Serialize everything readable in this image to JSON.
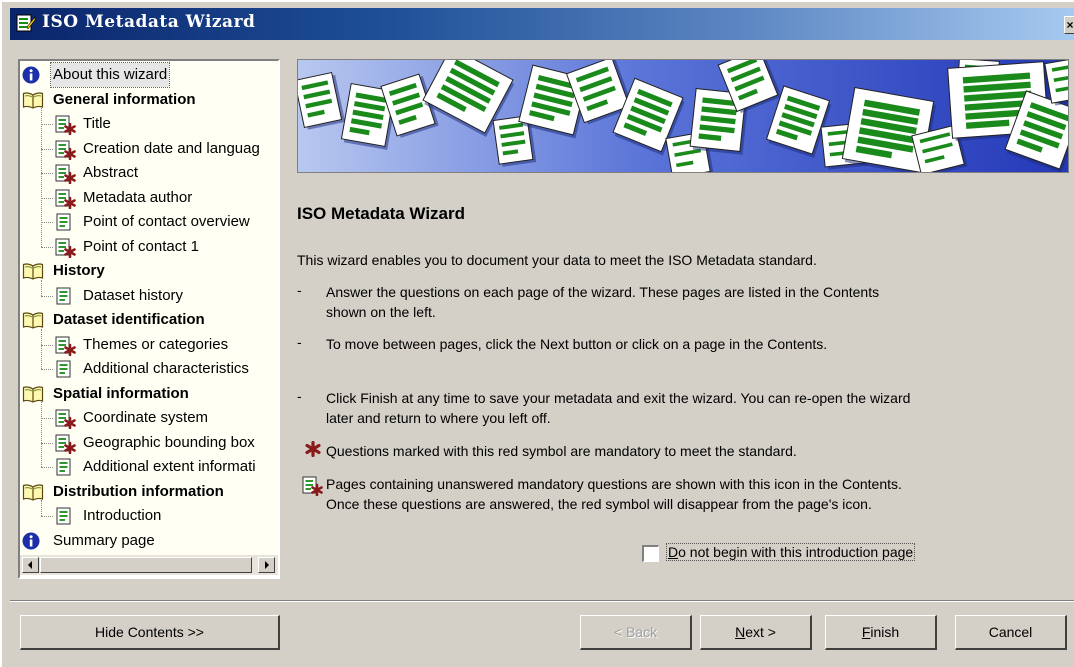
{
  "window": {
    "title": "ISO Metadata Wizard",
    "close_glyph": "×"
  },
  "tree": {
    "items": [
      {
        "label": "About this wizard",
        "level": 0,
        "icon": "info-icon",
        "bold": false,
        "selected": true
      },
      {
        "label": "General information",
        "level": 0,
        "icon": "book-icon",
        "bold": true
      },
      {
        "label": "Title",
        "level": 1,
        "icon": "page-mandatory-icon"
      },
      {
        "label": "Creation date and languag",
        "level": 1,
        "icon": "page-mandatory-icon"
      },
      {
        "label": "Abstract",
        "level": 1,
        "icon": "page-mandatory-icon"
      },
      {
        "label": "Metadata author",
        "level": 1,
        "icon": "page-mandatory-icon"
      },
      {
        "label": "Point of contact overview",
        "level": 1,
        "icon": "page-icon"
      },
      {
        "label": "Point of contact 1",
        "level": 1,
        "icon": "page-mandatory-icon"
      },
      {
        "label": "History",
        "level": 0,
        "icon": "book-icon",
        "bold": true
      },
      {
        "label": "Dataset history",
        "level": 1,
        "icon": "page-icon"
      },
      {
        "label": "Dataset identification",
        "level": 0,
        "icon": "book-icon",
        "bold": true
      },
      {
        "label": "Themes or categories",
        "level": 1,
        "icon": "page-mandatory-icon"
      },
      {
        "label": "Additional characteristics",
        "level": 1,
        "icon": "page-icon"
      },
      {
        "label": "Spatial information",
        "level": 0,
        "icon": "book-icon",
        "bold": true
      },
      {
        "label": "Coordinate system",
        "level": 1,
        "icon": "page-mandatory-icon"
      },
      {
        "label": "Geographic bounding box",
        "level": 1,
        "icon": "page-mandatory-icon"
      },
      {
        "label": "Additional extent informati",
        "level": 1,
        "icon": "page-icon"
      },
      {
        "label": "Distribution information",
        "level": 0,
        "icon": "book-icon",
        "bold": true
      },
      {
        "label": "Introduction",
        "level": 1,
        "icon": "page-icon"
      },
      {
        "label": "Summary page",
        "level": 0,
        "icon": "info-icon",
        "bold": false
      }
    ]
  },
  "content": {
    "heading": "ISO Metadata Wizard",
    "intro": "This wizard enables you to document your data to meet the ISO Metadata standard.",
    "bullet1_line1": "Answer the questions on each page of the wizard.  These pages are listed in the Contents",
    "bullet1_line2": "shown on the left.",
    "bullet2": "To move between pages, click the Next button or click on a page in the Contents.",
    "bullet3_line1": "Click Finish at any time to save your metadata and exit the wizard.  You can re-open the wizard",
    "bullet3_line2": "later and return to where you left off.",
    "dash": "-",
    "mandatory_note": "Questions marked with this red symbol are mandatory to meet the standard.",
    "icon_note_line1": "Pages containing unanswered mandatory questions are shown with this icon in the Contents.",
    "icon_note_line2": "Once these questions are answered, the red symbol will disappear from the page's icon.",
    "checkbox_label": "Do not begin with this introduction page",
    "checkbox_checked": false
  },
  "buttons": {
    "hide_contents": "Hide Contents >>",
    "back": "< Back",
    "next": "Next >",
    "finish": "Finish",
    "cancel": "Cancel"
  },
  "colors": {
    "titlebar_start": "#0a246a",
    "titlebar_end": "#a6caf0",
    "dialog_face": "#d4d0c8",
    "mandatory_red": "#8b1a1a",
    "banner_blue": "#2438b8",
    "page_green": "#1a8a1a"
  }
}
